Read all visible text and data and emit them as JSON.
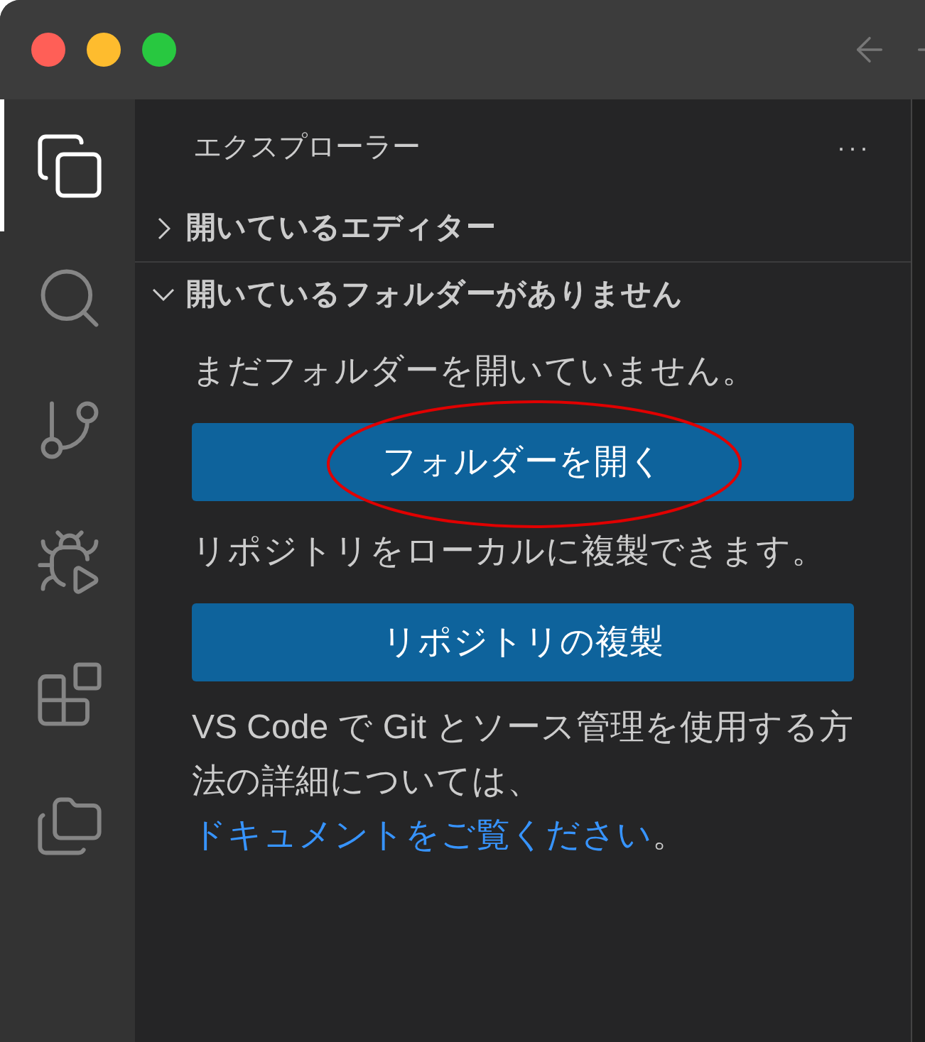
{
  "activity_bar": [
    {
      "selected": true
    },
    {
      "selected": false
    },
    {
      "selected": false
    },
    {
      "selected": false
    },
    {
      "selected": false
    },
    {
      "selected": false
    }
  ],
  "sidebar": {
    "title": "エクスプローラー",
    "more": "···",
    "sections": [
      {
        "label": "開いているエディター",
        "expanded": false
      },
      {
        "label": "開いているフォルダーがありません",
        "expanded": true
      }
    ]
  },
  "content": [
    {
      "kind": "text",
      "text": "まだフォルダーを開いていません。"
    },
    {
      "kind": "button",
      "label": "フォルダーを開く",
      "circled": true
    },
    {
      "kind": "text",
      "text": "リポジトリをローカルに複製できます。"
    },
    {
      "kind": "button",
      "label": "リポジトリの複製",
      "circled": false
    },
    {
      "kind": "link_text",
      "before": "VS Code で Git とソース管理を使用する方法の詳細については、",
      "link": "ドキュメントをご覧ください",
      "after": "。"
    }
  ]
}
